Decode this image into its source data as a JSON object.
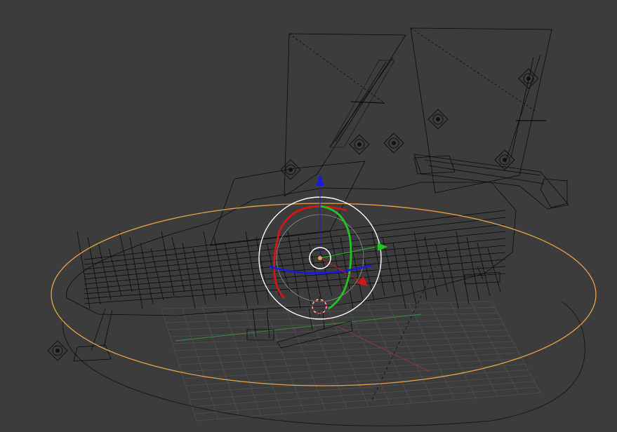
{
  "viewport": {
    "background": "#3c3c3c",
    "selection_outline_color": "#e8a34a",
    "wire_color": "#0b0b0b",
    "grid_color": "#4c4c4c"
  },
  "gizmo": {
    "axis_x_color": "#d01818",
    "axis_y_color": "#22c322",
    "axis_z_color": "#1a1ad8",
    "view_ring_color": "#ffffff",
    "pivot_color": "#e8a34a"
  },
  "icons": {
    "speaker": "speaker-icon",
    "gizmo_x": "x-axis-arrow-icon",
    "gizmo_y": "y-axis-arrow-icon",
    "gizmo_z": "z-axis-arrow-icon",
    "pivot": "pivot-point-icon"
  }
}
